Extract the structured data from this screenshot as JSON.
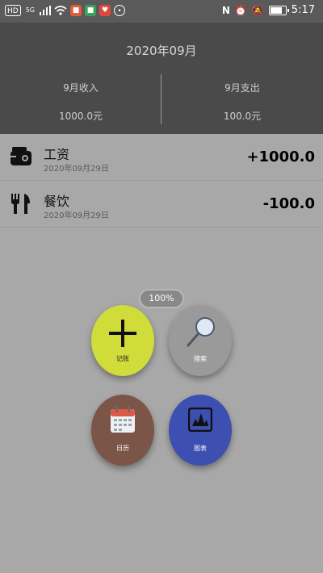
{
  "status_bar": {
    "left_badges": [
      "HD",
      "5G"
    ],
    "time": "5:17",
    "icons": [
      "hd-icon",
      "signal-icon",
      "wifi-icon",
      "app-badge-icon",
      "app-badge-icon",
      "heart-icon",
      "app-icon",
      "nfc-icon",
      "alarm-icon",
      "mute-icon",
      "battery-icon"
    ]
  },
  "header": {
    "month_title": "2020年09月",
    "income_label": "9月收入",
    "income_value": "1000.0元",
    "expense_label": "9月支出",
    "expense_value": "100.0元"
  },
  "records": [
    {
      "icon": "wallet-icon",
      "title": "工资",
      "date": "2020年09月29日",
      "amount": "+1000.0"
    },
    {
      "icon": "dining-icon",
      "title": "餐饮",
      "date": "2020年09月29日",
      "amount": "-100.0"
    }
  ],
  "menu": {
    "zoom": "100%",
    "add_label": "记账",
    "search_label": "搜索",
    "calendar_label": "日历",
    "chart_label": "图表"
  },
  "colors": {
    "background": "#a8a8a8",
    "header": "#4a4a4a",
    "add_button": "#d0dc3a",
    "search_button": "#9a9a9a",
    "calendar_button": "#7a5548",
    "chart_button": "#3d4fb0"
  }
}
